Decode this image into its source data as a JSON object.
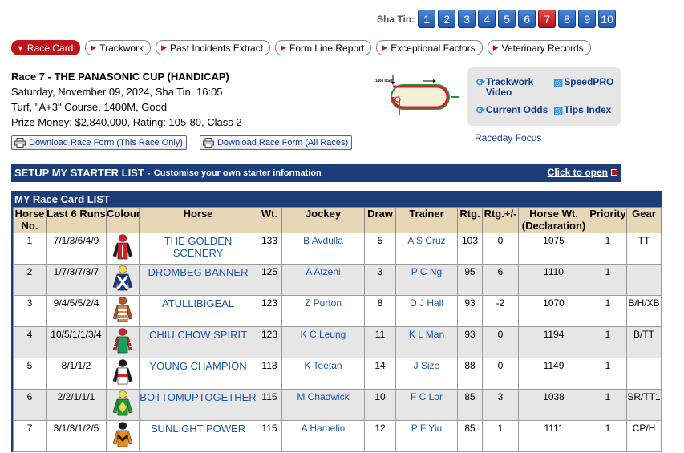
{
  "race_nav": {
    "label": "Sha Tin:",
    "races": [
      "1",
      "2",
      "3",
      "4",
      "5",
      "6",
      "7",
      "8",
      "9",
      "10"
    ],
    "active": "7"
  },
  "tabs": [
    "Race Card",
    "Trackwork",
    "Past Incidents Extract",
    "Form Line Report",
    "Exceptional Factors",
    "Veterinary Records"
  ],
  "race_info": {
    "title": "Race 7 - THE PANASONIC CUP (HANDICAP)",
    "date_line": "Saturday, November 09, 2024, Sha Tin, 16:05",
    "course_line": "Turf, \"A+3\" Course, 1400M, Good",
    "prize_line": "Prize Money: $2,840,000, Rating: 105-80, Class 2"
  },
  "downloads": {
    "this_race": "Download Race Form (This Race Only)",
    "all_races": "Download Race Form (All Races)"
  },
  "track_map": {
    "start_label": "1400 Start"
  },
  "quick_links": {
    "trackwork_video_1": "Trackwork",
    "trackwork_video_2": "Video",
    "speedpro": "SpeedPRO",
    "current_odds": "Current Odds",
    "tips_index": "Tips Index",
    "raceday_focus": "Raceday Focus"
  },
  "starter_list": {
    "title": "SETUP MY STARTER LIST -",
    "subtitle": "Customise your own starter information",
    "open_link": "Click to open"
  },
  "race_card": {
    "heading": "MY Race Card LIST",
    "columns": [
      "Horse No.",
      "Last 6 Runs",
      "Colour",
      "Horse",
      "Wt.",
      "Jockey",
      "Draw",
      "Trainer",
      "Rtg.",
      "Rtg.+/-",
      "Horse Wt. (Declaration)",
      "Priority",
      "Gear"
    ],
    "rows": [
      {
        "no": "1",
        "last6": "7/1/3/6/4/9",
        "horse": "THE GOLDEN SCENERY",
        "wt": "133",
        "jockey": "B Avdulla",
        "draw": "5",
        "trainer": "A S Cruz",
        "rtg": "103",
        "rtg_change": "0",
        "horse_wt": "1075",
        "priority": "1",
        "gear": "TT",
        "silk": {
          "cap": "#d21f2a",
          "body": "#d21f2a",
          "stripe": "#ffffff",
          "sleeve": "#1c1c1c",
          "pattern": "plain"
        }
      },
      {
        "no": "2",
        "last6": "1/7/3/7/3/7",
        "horse": "DROMBEG BANNER",
        "wt": "125",
        "jockey": "A Atzeni",
        "draw": "3",
        "trainer": "P C Ng",
        "rtg": "95",
        "rtg_change": "6",
        "horse_wt": "1110",
        "priority": "1",
        "gear": "",
        "silk": {
          "cap": "#f2d94a",
          "body": "#173a8a",
          "stripe": "#ffffff",
          "sleeve": "#173a8a",
          "pattern": "cross"
        }
      },
      {
        "no": "3",
        "last6": "9/4/5/5/2/4",
        "horse": "ATULLIBIGEAL",
        "wt": "123",
        "jockey": "Z Purton",
        "draw": "8",
        "trainer": "D J Hall",
        "rtg": "93",
        "rtg_change": "-2",
        "horse_wt": "1070",
        "priority": "1",
        "gear": "B/H/XB",
        "silk": {
          "cap": "#b5552a",
          "body": "#d98a4a",
          "stripe": "#ffffff",
          "sleeve": "#b5552a",
          "pattern": "bars"
        }
      },
      {
        "no": "4",
        "last6": "10/5/1/1/3/4",
        "horse": "CHIU CHOW SPIRIT",
        "wt": "123",
        "jockey": "K C Leung",
        "draw": "11",
        "trainer": "K L Man",
        "rtg": "93",
        "rtg_change": "0",
        "horse_wt": "1194",
        "priority": "1",
        "gear": "B/TT",
        "silk": {
          "cap": "#d21f2a",
          "body": "#1d9c5a",
          "stripe": "#d21f2a",
          "sleeve": "#d21f2a",
          "pattern": "hoops"
        }
      },
      {
        "no": "5",
        "last6": "8/1/1/2",
        "horse": "YOUNG CHAMPION",
        "wt": "118",
        "jockey": "K Teetan",
        "draw": "14",
        "trainer": "J Size",
        "rtg": "88",
        "rtg_change": "0",
        "horse_wt": "1149",
        "priority": "1",
        "gear": "",
        "silk": {
          "cap": "#1c1c1c",
          "body": "#ffffff",
          "stripe": "#d21f2a",
          "sleeve": "#1c1c1c",
          "pattern": "band"
        }
      },
      {
        "no": "6",
        "last6": "2/2/1/1/1",
        "horse": "BOTTOMUPTOGETHER",
        "wt": "115",
        "jockey": "M Chadwick",
        "draw": "10",
        "trainer": "F C Lor",
        "rtg": "85",
        "rtg_change": "3",
        "horse_wt": "1038",
        "priority": "1",
        "gear": "SR/TT1",
        "silk": {
          "cap": "#f2d94a",
          "body": "#1d9c3a",
          "stripe": "#f2d94a",
          "sleeve": "#1d9c3a",
          "pattern": "diamond"
        }
      },
      {
        "no": "7",
        "last6": "3/1/3/1/2/5",
        "horse": "SUNLIGHT POWER",
        "wt": "115",
        "jockey": "A Hamelin",
        "draw": "12",
        "trainer": "P F Yiu",
        "rtg": "85",
        "rtg_change": "1",
        "horse_wt": "1111",
        "priority": "1",
        "gear": "CP/H",
        "silk": {
          "cap": "#1c1c1c",
          "body": "#f08a1c",
          "stripe": "#1c1c1c",
          "sleeve": "#f08a1c",
          "pattern": "chevron"
        }
      }
    ]
  }
}
